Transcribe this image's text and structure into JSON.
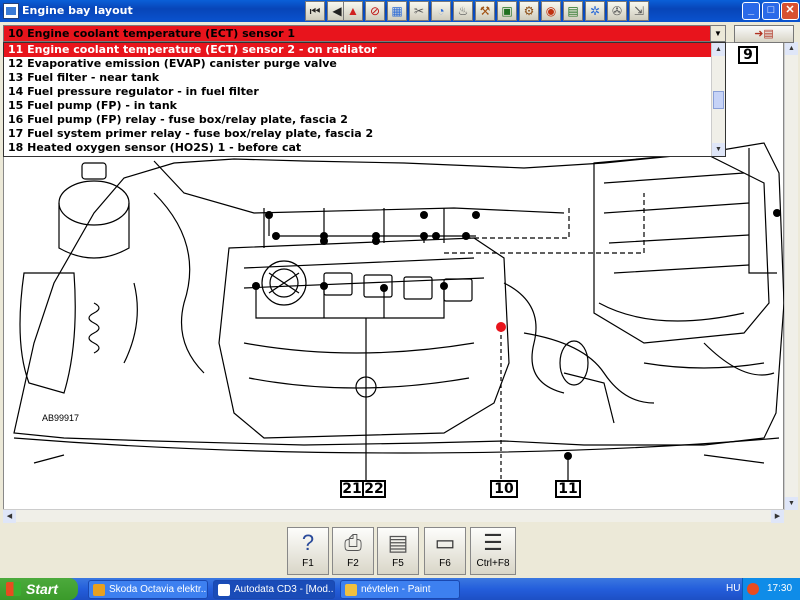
{
  "window": {
    "title": "Engine bay layout",
    "controls": [
      "_",
      "□",
      "✕"
    ]
  },
  "toolbar": {
    "icons": [
      "first-icon",
      "prev-icon",
      "warning-icon",
      "no-entry-icon",
      "diagram-icon",
      "tools-icon",
      "gauge-icon",
      "seat-icon",
      "wrench-icon",
      "car-icon",
      "engine-icon",
      "relay-icon",
      "chart-icon",
      "cog-icon",
      "wheel-icon",
      "exit-icon"
    ]
  },
  "selector": {
    "selected": "10  Engine coolant temperature (ECT) sensor 1",
    "side_button_icon": "print-icon"
  },
  "list": {
    "items": [
      "11  Engine coolant temperature (ECT) sensor 2 - on radiator",
      "12  Evaporative emission (EVAP) canister purge valve",
      "13  Fuel filter - near tank",
      "14  Fuel pressure regulator - in fuel filter",
      "15  Fuel pump (FP) - in tank",
      "16  Fuel pump (FP) relay - fuse box/relay plate, fascia 2",
      "17  Fuel system primer relay - fuse box/relay plate, fascia 2",
      "18  Heated oxygen sensor (HO2S) 1 - before cat"
    ],
    "selected_index": 0
  },
  "diagram": {
    "ref_code": "AB99917",
    "callouts": {
      "c9": "9",
      "c21": "21",
      "c22": "22",
      "c10": "10",
      "c11": "11"
    },
    "highlight_color": "#e8141c"
  },
  "fkeys": [
    {
      "label": "F1",
      "icon": "help-icon"
    },
    {
      "label": "F2",
      "icon": "printer-icon"
    },
    {
      "label": "F5",
      "icon": "document-icon"
    },
    {
      "label": "F6",
      "icon": "print-preview-icon"
    },
    {
      "label": "Ctrl+F8",
      "icon": "table-icon"
    }
  ],
  "taskbar": {
    "start": "Start",
    "tasks": [
      "Skoda Octavia elektr...",
      "Autodata CD3 - [Mod...",
      "névtelen - Paint"
    ],
    "lang": "HU",
    "clock": "17:30"
  }
}
